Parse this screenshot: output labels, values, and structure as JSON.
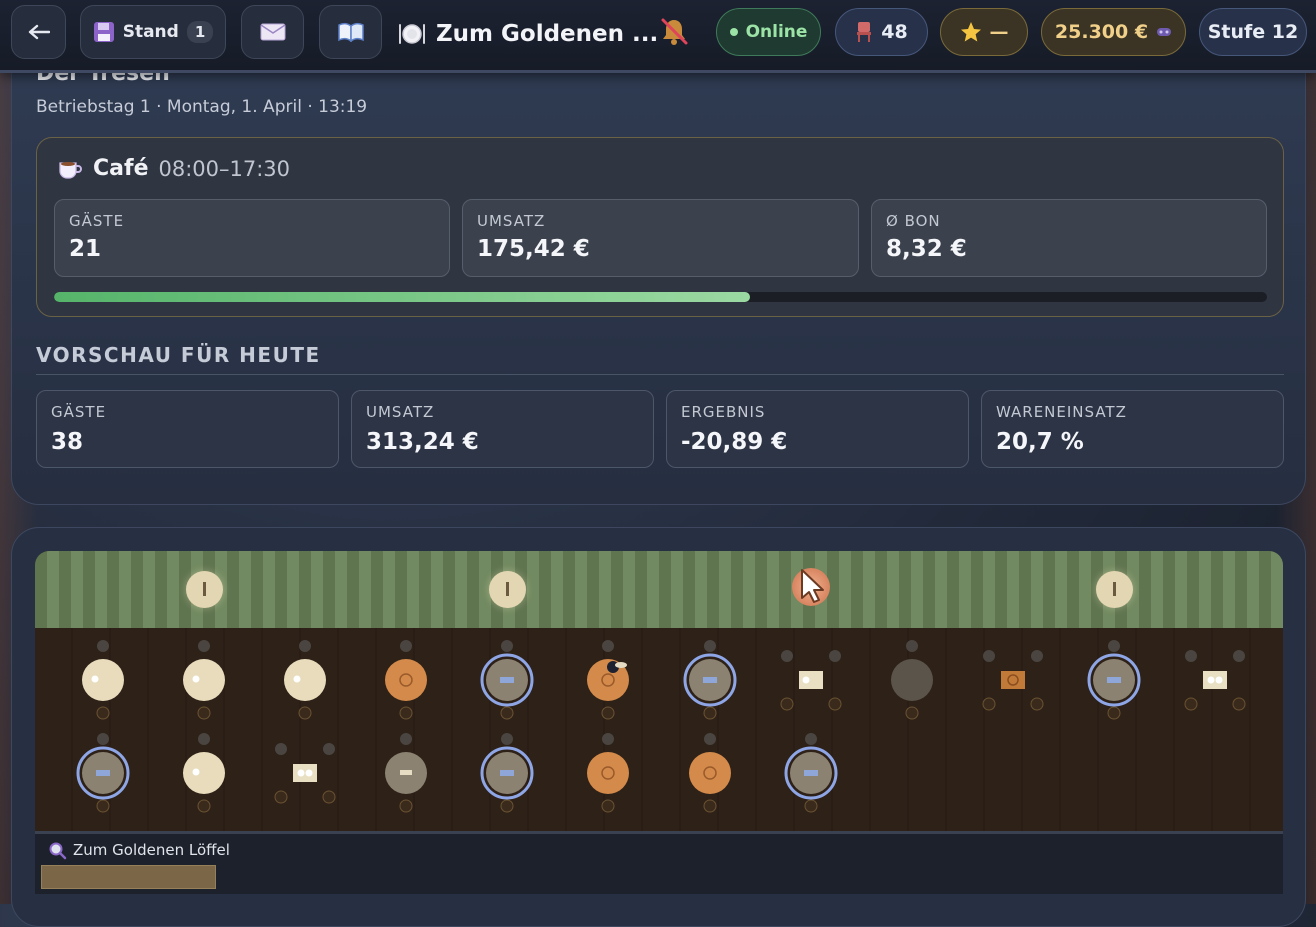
{
  "topbar": {
    "back_icon": "arrow-left",
    "save_label": "Stand",
    "save_count": "1",
    "mail_icon": "envelope",
    "book_icon": "book",
    "restaurant_name": "Zum Goldenen ...",
    "status": "Online",
    "seats": "48",
    "rating": "—",
    "money": "25.300 €",
    "level": "Stufe 12"
  },
  "header": {
    "title": "Der Tresen",
    "subtitle": "Betriebstag 1 · Montag, 1. April · 13:19"
  },
  "cafe": {
    "name": "Café",
    "hours": "08:00–17:30",
    "progress": 0.574,
    "stats": [
      {
        "label": "GÄSTE",
        "value": "21"
      },
      {
        "label": "UMSATZ",
        "value": "175,42 €"
      },
      {
        "label": "Ø BON",
        "value": "8,32 €"
      }
    ]
  },
  "preview": {
    "title": "VORSCHAU FÜR HEUTE",
    "stats": [
      {
        "label": "GÄSTE",
        "value": "38"
      },
      {
        "label": "UMSATZ",
        "value": "313,24 €"
      },
      {
        "label": "ERGEBNIS",
        "value": "-20,89 €"
      },
      {
        "label": "WARENEINSATZ",
        "value": "20,7 %"
      }
    ]
  },
  "floor": {
    "caption": "Zum Goldenen Löffel"
  },
  "colors": {
    "online": "#9be3a6",
    "money": "#f1d08a",
    "accent_ring": "#8ea6e6",
    "table_cream": "#e8dcbc",
    "table_orange": "#d38a4a",
    "table_grey": "#8b8271"
  }
}
